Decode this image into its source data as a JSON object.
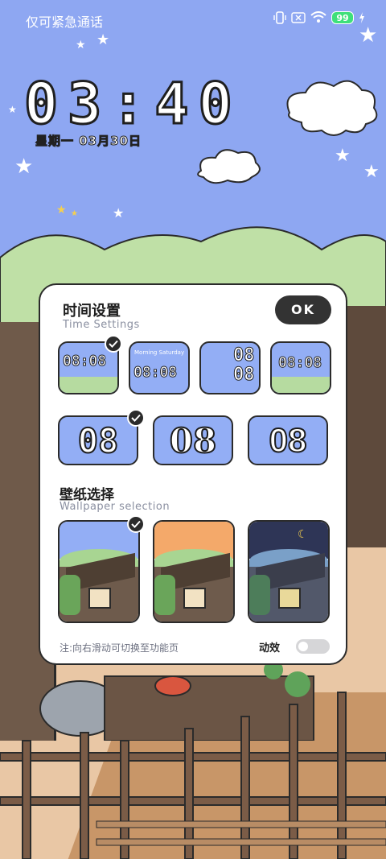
{
  "status_bar": {
    "carrier_text": "仅可紧急通话",
    "battery_level": "99"
  },
  "lockscreen": {
    "time": "03:40",
    "date": "星期一  03月30日"
  },
  "time_settings": {
    "title_zh": "时间设置",
    "title_en": "Time Settings",
    "ok_label": "OK",
    "styles": [
      {
        "time": "08:08",
        "sub": "",
        "selected": true
      },
      {
        "time": "08:08",
        "sub": "Morning Saturday",
        "selected": false
      },
      {
        "time": "08 08",
        "sub": "",
        "selected": false
      },
      {
        "time": "08:08",
        "sub": "",
        "selected": false
      }
    ],
    "digit_styles": [
      {
        "label": "08",
        "selected": true
      },
      {
        "label": "08",
        "selected": false
      },
      {
        "label": "08",
        "selected": false
      }
    ]
  },
  "wallpaper_selection": {
    "title_zh": "壁纸选择",
    "title_en": "Wallpaper selection",
    "options": [
      {
        "theme": "day",
        "sky_color": "#93aef5",
        "selected": true
      },
      {
        "theme": "sunset",
        "sky_color": "#f4a96a",
        "selected": false
      },
      {
        "theme": "night",
        "sky_color": "#2e3556",
        "selected": false
      }
    ]
  },
  "footer": {
    "note": "注:向右滑动可切换至功能页",
    "animation_label": "动效",
    "animation_enabled": false
  },
  "colors": {
    "tile_blue": "#93aef5",
    "dark": "#2b2b2b",
    "battery_green": "#3ee07a"
  }
}
